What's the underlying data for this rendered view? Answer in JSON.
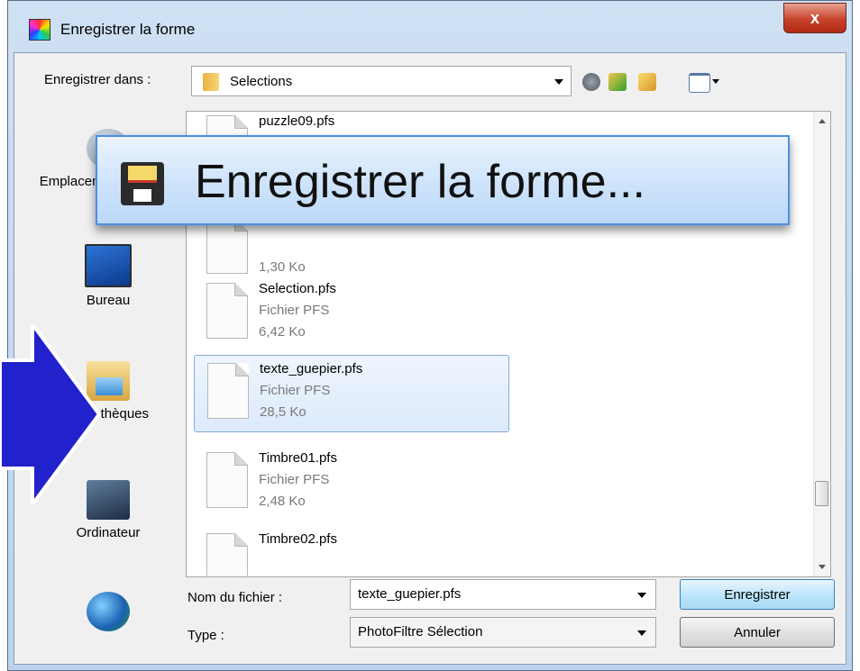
{
  "window": {
    "title": "Enregistrer la forme",
    "close_label": "x"
  },
  "lookin": {
    "label": "Enregistrer dans :",
    "value": "Selections"
  },
  "toolbar": {
    "icons": [
      "back-icon",
      "up-folder-icon",
      "new-folder-icon",
      "view-menu-icon"
    ]
  },
  "places": [
    {
      "label": "Emplacements récents",
      "icon": "recent-places-icon"
    },
    {
      "label": "Bureau",
      "icon": "desktop-icon"
    },
    {
      "label": "Bibliothèques",
      "icon": "libraries-icon"
    },
    {
      "label": "Ordinateur",
      "icon": "computer-icon"
    },
    {
      "label": "",
      "icon": "network-icon"
    }
  ],
  "files": [
    {
      "name": "puzzle09.pfs",
      "type": "",
      "size": ""
    },
    {
      "name": "",
      "type": "",
      "size": "1,30 Ko"
    },
    {
      "name": "Selection.pfs",
      "type": "Fichier PFS",
      "size": "6,42 Ko"
    },
    {
      "name": "texte_guepier.pfs",
      "type": "Fichier PFS",
      "size": "28,5 Ko",
      "selected": true
    },
    {
      "name": "Timbre01.pfs",
      "type": "Fichier PFS",
      "size": "2,48 Ko"
    },
    {
      "name": "Timbre02.pfs",
      "type": "",
      "size": ""
    }
  ],
  "filename": {
    "label": "Nom du fichier :",
    "value": "texte_guepier.pfs"
  },
  "filetype": {
    "label": "Type :",
    "value": "PhotoFiltre Sélection"
  },
  "buttons": {
    "save": "Enregistrer",
    "cancel": "Annuler"
  },
  "banner": {
    "text": "Enregistrer la forme..."
  },
  "colors": {
    "accent": "#4a90e2",
    "arrow": "#2222cc",
    "selection": "#dceafc"
  }
}
